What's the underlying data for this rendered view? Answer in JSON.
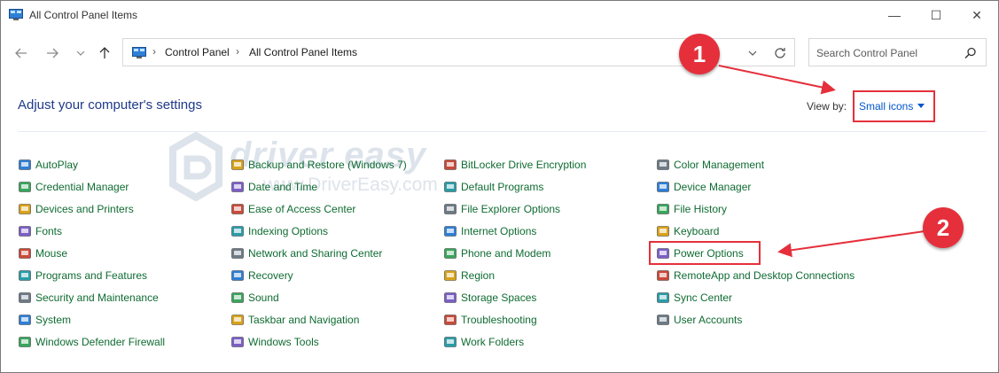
{
  "window": {
    "title": "All Control Panel Items",
    "controls": {
      "minimize": "—",
      "maximize": "☐",
      "close": "✕"
    }
  },
  "nav": {
    "back_icon": "arrow-left-icon",
    "forward_icon": "arrow-right-icon",
    "recent_icon": "chevron-down-icon",
    "up_icon": "arrow-up-icon"
  },
  "address": {
    "crumbs": [
      "Control Panel",
      "All Control Panel Items"
    ],
    "separator": "›"
  },
  "search": {
    "placeholder": "Search Control Panel"
  },
  "header": {
    "title": "Adjust your computer's settings",
    "view_by_label": "View by:",
    "view_by_value": "Small icons"
  },
  "watermark": {
    "brand": "driver easy",
    "url": "www.DriverEasy.com"
  },
  "annotations": {
    "badge1": "1",
    "badge2": "2",
    "accent_color": "#e5303c"
  },
  "colors": {
    "item_link": "#0f6b32",
    "title": "#1e3a8a",
    "link": "#0055cc"
  },
  "columns": [
    [
      {
        "label": "AutoPlay",
        "icon": "autoplay-icon"
      },
      {
        "label": "Credential Manager",
        "icon": "credential-manager-icon"
      },
      {
        "label": "Devices and Printers",
        "icon": "printer-icon"
      },
      {
        "label": "Fonts",
        "icon": "fonts-icon"
      },
      {
        "label": "Mouse",
        "icon": "mouse-icon"
      },
      {
        "label": "Programs and Features",
        "icon": "programs-icon"
      },
      {
        "label": "Security and Maintenance",
        "icon": "flag-icon"
      },
      {
        "label": "System",
        "icon": "system-icon"
      },
      {
        "label": "Windows Defender Firewall",
        "icon": "firewall-icon"
      }
    ],
    [
      {
        "label": "Backup and Restore (Windows 7)",
        "icon": "backup-icon"
      },
      {
        "label": "Date and Time",
        "icon": "clock-icon"
      },
      {
        "label": "Ease of Access Center",
        "icon": "accessibility-icon"
      },
      {
        "label": "Indexing Options",
        "icon": "indexing-icon"
      },
      {
        "label": "Network and Sharing Center",
        "icon": "network-icon"
      },
      {
        "label": "Recovery",
        "icon": "recovery-icon"
      },
      {
        "label": "Sound",
        "icon": "speaker-icon"
      },
      {
        "label": "Taskbar and Navigation",
        "icon": "taskbar-icon"
      },
      {
        "label": "Windows Tools",
        "icon": "tools-icon"
      }
    ],
    [
      {
        "label": "BitLocker Drive Encryption",
        "icon": "bitlocker-icon"
      },
      {
        "label": "Default Programs",
        "icon": "default-programs-icon"
      },
      {
        "label": "File Explorer Options",
        "icon": "folder-options-icon"
      },
      {
        "label": "Internet Options",
        "icon": "globe-icon"
      },
      {
        "label": "Phone and Modem",
        "icon": "phone-icon"
      },
      {
        "label": "Region",
        "icon": "region-icon"
      },
      {
        "label": "Storage Spaces",
        "icon": "storage-icon"
      },
      {
        "label": "Troubleshooting",
        "icon": "troubleshoot-icon"
      },
      {
        "label": "Work Folders",
        "icon": "work-folders-icon"
      }
    ],
    [
      {
        "label": "Color Management",
        "icon": "monitor-color-icon"
      },
      {
        "label": "Device Manager",
        "icon": "device-manager-icon"
      },
      {
        "label": "File History",
        "icon": "file-history-icon"
      },
      {
        "label": "Keyboard",
        "icon": "keyboard-icon"
      },
      {
        "label": "Power Options",
        "icon": "power-options-icon"
      },
      {
        "label": "RemoteApp and Desktop Connections",
        "icon": "remoteapp-icon"
      },
      {
        "label": "Sync Center",
        "icon": "sync-icon"
      },
      {
        "label": "User Accounts",
        "icon": "users-icon"
      }
    ]
  ]
}
